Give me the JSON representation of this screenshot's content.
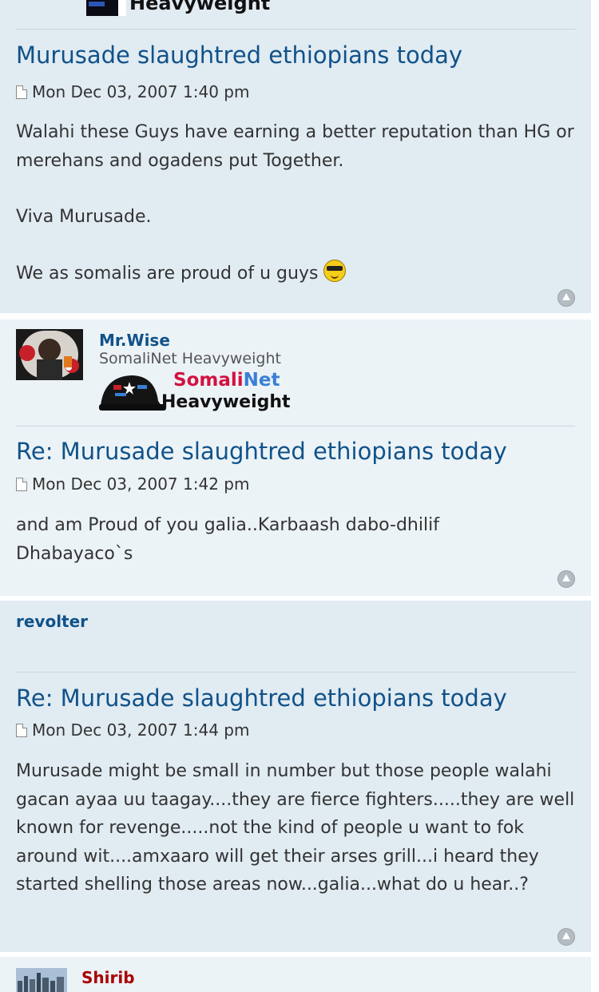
{
  "posts": [
    {
      "author": "",
      "rank_label": "Heavyweight",
      "title": "Murusade slaughtred ethiopians today",
      "date": "Mon Dec 03, 2007 1:40 pm",
      "paragraphs": [
        "Walahi these Guys have earning a better reputation than HG or merehans and ogadens put Together.",
        "Viva Murusade.",
        "We as somalis are proud of u guys"
      ],
      "smiley": "cool-smiley-icon"
    },
    {
      "author": "Mr.Wise",
      "rank": "SomaliNet Heavyweight",
      "rank_badge": {
        "brand_a": "Somali",
        "brand_b": "Net",
        "label": "Heavyweight"
      },
      "title": "Re: Murusade slaughtred ethiopians today",
      "date": "Mon Dec 03, 2007 1:42 pm",
      "paragraphs": [
        "and am Proud of you galia..Karbaash dabo-dhilif Dhabayaco`s"
      ]
    },
    {
      "author": "revolter",
      "title": "Re: Murusade slaughtred ethiopians today",
      "date": "Mon Dec 03, 2007 1:44 pm",
      "paragraphs": [
        "Murusade might be small in number but those people walahi gacan ayaa uu taagay....they are fierce fighters.....they are well known for revenge.....not the kind of people u want to fok around wit....amxaaro will get their arses grill...i heard they started shelling those areas now...galia...what do u hear..?"
      ]
    },
    {
      "author": "Shirib"
    }
  ],
  "colors": {
    "post_bg_a": "#e1ebf2",
    "post_bg_b": "#ecf3f7",
    "title": "#105289",
    "shirib_name": "#aa0000",
    "badge_red": "#d31141",
    "badge_blue": "#3a7fd5"
  },
  "icons": {
    "post": "post-icon",
    "top": "back-to-top-icon"
  }
}
